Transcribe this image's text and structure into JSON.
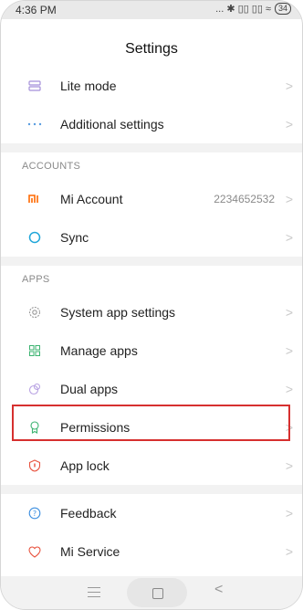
{
  "status": {
    "time": "4:36 PM",
    "signal": "... ✱ ▯▯ ▯▯ ≈",
    "battery": "34"
  },
  "header": {
    "title": "Settings"
  },
  "top_items": [
    {
      "label": "Lite mode",
      "icon": "lite-mode-icon"
    },
    {
      "label": "Additional settings",
      "icon": "more-dots-icon"
    }
  ],
  "accounts": {
    "section": "ACCOUNTS",
    "items": [
      {
        "label": "Mi Account",
        "value": "2234652532",
        "icon": "mi-logo-icon"
      },
      {
        "label": "Sync",
        "icon": "sync-icon"
      }
    ]
  },
  "apps": {
    "section": "APPS",
    "items": [
      {
        "label": "System app settings",
        "icon": "gear-icon"
      },
      {
        "label": "Manage apps",
        "icon": "grid-icon"
      },
      {
        "label": "Dual apps",
        "icon": "dual-apps-icon"
      },
      {
        "label": "Permissions",
        "icon": "permissions-icon"
      },
      {
        "label": "App lock",
        "icon": "lock-icon"
      }
    ]
  },
  "bottom_items": [
    {
      "label": "Feedback",
      "icon": "help-icon"
    },
    {
      "label": "Mi Service",
      "icon": "heart-icon"
    }
  ],
  "chevron": ">",
  "nav": {
    "back": "<"
  },
  "colors": {
    "accent_red": "#d6302f",
    "mi_orange": "#ff6900",
    "sync_teal": "#1fa6d9"
  }
}
